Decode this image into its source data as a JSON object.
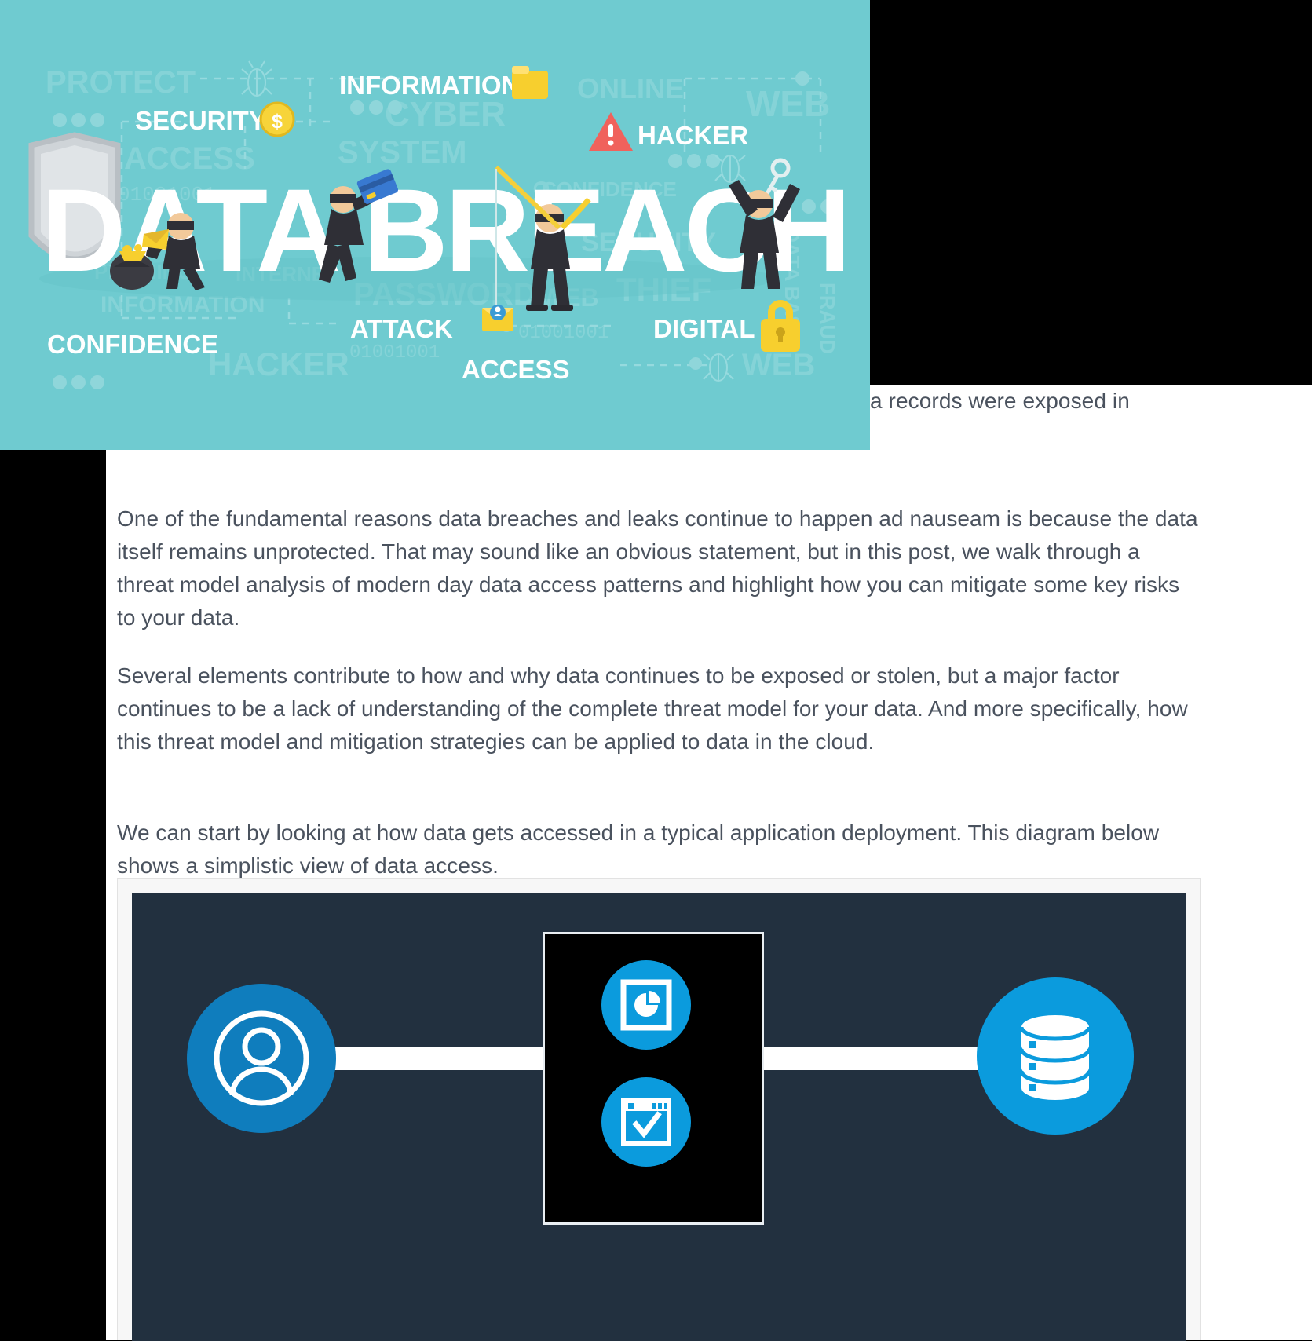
{
  "hero": {
    "title_main": "DATA BREACH",
    "labels_white": [
      "SECURITY",
      "INFORMATION",
      "HACKER",
      "ATTACK",
      "ACCESS",
      "DIGITAL",
      "CONFIDENCE"
    ],
    "labels_ghost": [
      "PROTECT",
      "CYBER",
      "ONLINE",
      "WEB",
      "ACCESS",
      "SYSTEM",
      "PASSWORD",
      "WEB",
      "THIEF",
      "INFORMATION",
      "HACKER",
      "WEB",
      "INTERNET",
      "FRAUD",
      "DATA BASE",
      "SECURITY",
      "CONFIDENCE"
    ],
    "binary_strings": [
      "01001001",
      "01001001",
      "010 1001"
    ],
    "icons": [
      "folder-icon",
      "coin-dollar-icon",
      "warning-triangle-icon",
      "padlock-icon",
      "key-icon",
      "shield-icon",
      "bug-icon",
      "envelope-icon",
      "credit-card-icon",
      "fishing-rod-icon",
      "money-bag-icon"
    ],
    "background_color": "#6fcbd0"
  },
  "top_fragment": {
    "text": "a records were exposed in"
  },
  "article": {
    "paragraphs": [
      "One of the fundamental reasons data breaches and leaks continue to happen ad nauseam is because the data itself remains unprotected.  That may sound like an obvious statement, but in this post, we walk through a threat model analysis of modern day data access patterns and highlight how you can mitigate some key risks to your data.",
      "Several elements contribute to how and why data continues to be exposed or stolen, but a major factor continues to be a lack of understanding of the complete threat model for your data.  And more specifically, how this threat model and mitigation strategies can be applied to data in the cloud.",
      "We can start by looking at how data gets accessed in a typical application deployment.  This diagram below shows a simplistic view of data access."
    ],
    "text_color": "#4a525e"
  },
  "diagram": {
    "background_color": "#22303f",
    "accent_color": "#0b9bdd",
    "node_user": "user-icon",
    "node_app_top": "pie-chart-app-icon",
    "node_app_bottom": "browser-window-check-icon",
    "node_database": "database-icon",
    "connector_color": "#ffffff",
    "app_panel_color": "#000000"
  }
}
